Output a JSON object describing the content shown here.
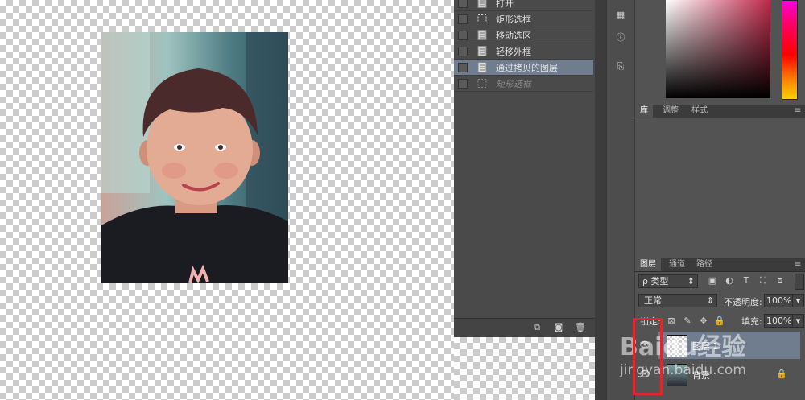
{
  "history": {
    "items": [
      {
        "label": "打开",
        "icon": "document-icon",
        "state": "normal"
      },
      {
        "label": "矩形选框",
        "icon": "marquee-icon",
        "state": "normal"
      },
      {
        "label": "移动选区",
        "icon": "document-icon",
        "state": "normal"
      },
      {
        "label": "轻移外框",
        "icon": "document-icon",
        "state": "normal"
      },
      {
        "label": "通过拷贝的图层",
        "icon": "document-icon",
        "state": "selected"
      },
      {
        "label": "矩形选框",
        "icon": "marquee-icon",
        "state": "dimmed"
      }
    ]
  },
  "library_panel": {
    "tabs": [
      "库",
      "调整",
      "样式"
    ]
  },
  "layers_panel": {
    "tabs": [
      "图层",
      "通道",
      "路径"
    ],
    "filter_label": "ρ 类型",
    "blend_mode": "正常",
    "opacity_label": "不透明度:",
    "opacity_value": "100%",
    "lock_label": "锁定:",
    "fill_label": "填充:",
    "fill_value": "100%",
    "layers": [
      {
        "name": "图层 1",
        "selected": true
      },
      {
        "name": "背景",
        "selected": false,
        "locked": true
      }
    ]
  },
  "watermark": {
    "brand": "Baidu经验",
    "url": "jingyan.baidu.com"
  },
  "colors": {
    "highlight": "#6f7d8f",
    "annotation": "#e0272f"
  }
}
